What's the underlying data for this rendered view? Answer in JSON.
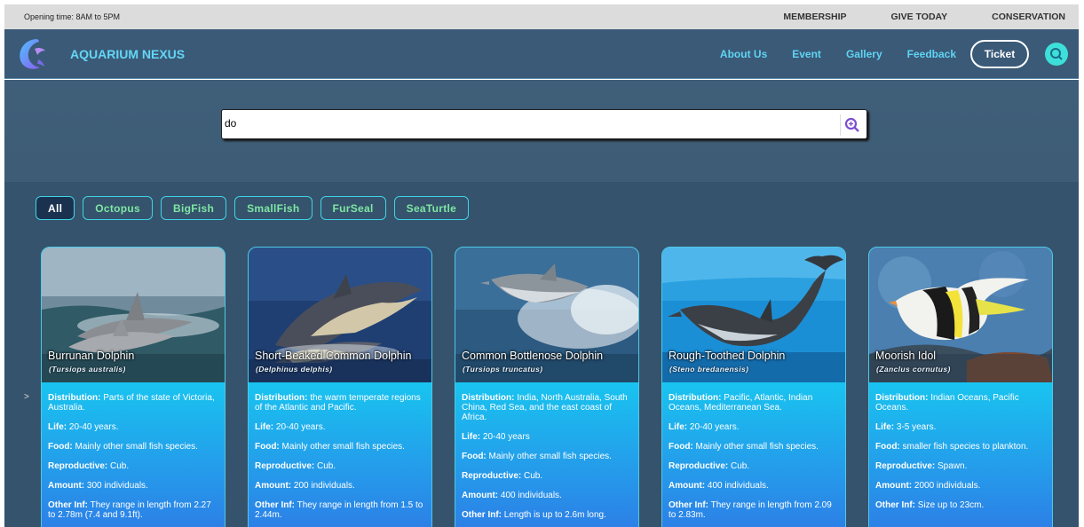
{
  "topbar": {
    "opening": "Opening time: 8AM to 5PM",
    "links": [
      "MEMBERSHIP",
      "GIVE TODAY",
      "CONSERVATION"
    ]
  },
  "header": {
    "brand": "AQUARIUM NEXUS",
    "nav": [
      "About Us",
      "Event",
      "Gallery",
      "Feedback"
    ],
    "ticket": "Ticket"
  },
  "search": {
    "value": "do"
  },
  "filters": [
    "All",
    "Octopus",
    "BigFish",
    "SmallFish",
    "FurSeal",
    "SeaTurtle"
  ],
  "arrow": ">",
  "labels": {
    "distribution": "Distribution:",
    "life": "Life:",
    "food": "Food:",
    "reproductive": "Reproductive:",
    "amount": "Amount:",
    "other": "Other Inf:"
  },
  "cards": [
    {
      "name": "Burrunan Dolphin",
      "scientific": "(Tursiops australis)",
      "distribution": "Parts of the state of Victoria, Australia.",
      "life": "20-40 years.",
      "food": "Mainly other small fish species.",
      "reproductive": "Cub.",
      "amount": "300 individuals.",
      "other": "They range in length from 2.27 to 2.78m (7.4 and 9.1ft)."
    },
    {
      "name": "Short-Beaked Common Dolphin",
      "scientific": "(Delphinus delphis)",
      "distribution": "the warm temperate regions of the Atlantic and Pacific.",
      "life": "20-40 years.",
      "food": "Mainly other small fish species.",
      "reproductive": "Cub.",
      "amount": "200 individuals.",
      "other": "They range in length from 1.5 to 2.44m."
    },
    {
      "name": "Common Bottlenose Dolphin",
      "scientific": "(Tursiops truncatus)",
      "distribution": "India, North Australia, South China, Red Sea, and the east coast of Africa.",
      "life": "20-40 years",
      "food": "Mainly other small fish species.",
      "reproductive": "Cub.",
      "amount": "400 individuals.",
      "other": "Length is up to 2.6m long."
    },
    {
      "name": "Rough-Toothed Dolphin",
      "scientific": "(Steno bredanensis)",
      "distribution": "Pacific, Atlantic, Indian Oceans, Mediterranean Sea.",
      "life": "20-40 years.",
      "food": "Mainly other small fish species.",
      "reproductive": "Cub.",
      "amount": "400 individuals.",
      "other": "They range in length from 2.09 to 2.83m."
    },
    {
      "name": "Moorish Idol",
      "scientific": "(Zanclus cornutus)",
      "distribution": "Indian Oceans, Pacific Oceans.",
      "life": "3-5 years.",
      "food": "smaller fish species to plankton.",
      "reproductive": "Spawn.",
      "amount": "2000 individuals.",
      "other": "Size up to 23cm."
    }
  ]
}
